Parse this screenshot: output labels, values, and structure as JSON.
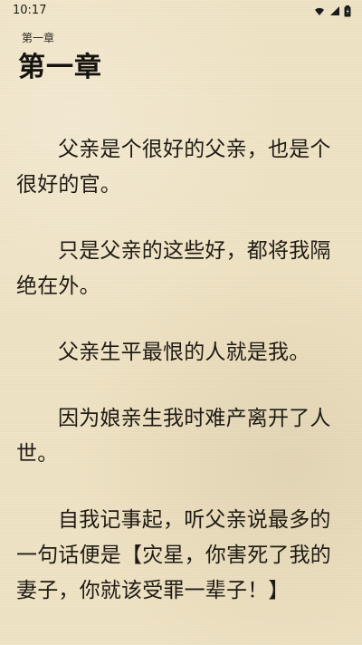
{
  "status_bar": {
    "time": "10:17",
    "icons": [
      "wifi-icon",
      "signal-icon",
      "battery-icon"
    ]
  },
  "chapter": {
    "small_label": "第一章",
    "title": "第一章"
  },
  "content": {
    "paragraphs": [
      "父亲是个很好的父亲，也是个很好的官。",
      "只是父亲的这些好，都将我隔绝在外。",
      "父亲生平最恨的人就是我。",
      "因为娘亲生我时难产离开了人世。",
      "自我记事起，听父亲说最多的一句话便是【灾星，你害死了我的妻子，你就该受罪一辈子！】"
    ]
  }
}
